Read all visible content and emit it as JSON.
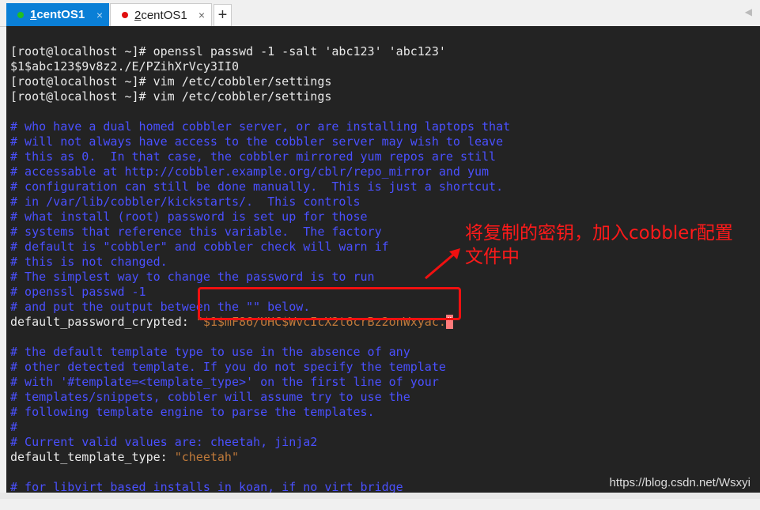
{
  "tabs": [
    {
      "number": "1",
      "label": " centOS1",
      "status_color": "#22c022",
      "active": true
    },
    {
      "number": "2",
      "label": " centOS1",
      "status_color": "#e01010",
      "active": false
    }
  ],
  "add_tab_label": "+",
  "close_glyph": "×",
  "terminal": {
    "shell_lines": [
      "[root@localhost ~]# openssl passwd -1 -salt 'abc123' 'abc123'",
      "$1$abc123$9v8z2./E/PZihXrVcy3II0",
      "[root@localhost ~]# vim /etc/cobbler/settings",
      "[root@localhost ~]# vim /etc/cobbler/settings"
    ],
    "comment_block1": [
      "# who have a dual homed cobbler server, or are installing laptops that",
      "# will not always have access to the cobbler server may wish to leave",
      "# this as 0.  In that case, the cobbler mirrored yum repos are still",
      "# accessable at http://cobbler.example.org/cblr/repo_mirror and yum",
      "# configuration can still be done manually.  This is just a shortcut.",
      "# in /var/lib/cobbler/kickstarts/.  This controls",
      "# what install (root) password is set up for those",
      "# systems that reference this variable.  The factory",
      "# default is \"cobbler\" and cobbler check will warn if",
      "# this is not changed.",
      "# The simplest way to change the password is to run",
      "# openssl passwd -1",
      "# and put the output between the \"\" below."
    ],
    "password_key": "default_password_crypted: ",
    "password_value": "\"$1$mF86/UHC$WvcIcX2t6crBz2onWxyac.",
    "password_cursor": "\"",
    "comment_block2": [
      "# the default template type to use in the absence of any",
      "# other detected template. If you do not specify the template",
      "# with '#template=<template_type>' on the first line of your",
      "# templates/snippets, cobbler will assume try to use the",
      "# following template engine to parse the templates.",
      "#",
      "# Current valid values are: cheetah, jinja2"
    ],
    "template_key": "default_template_type: ",
    "template_value": "\"cheetah\"",
    "last_comment": "# for libvirt based installs in koan, if no virt bridge"
  },
  "annotation": "将复制的密钥，加入cobbler配置文件中",
  "watermark": "https://blog.csdn.net/Wsxyi"
}
